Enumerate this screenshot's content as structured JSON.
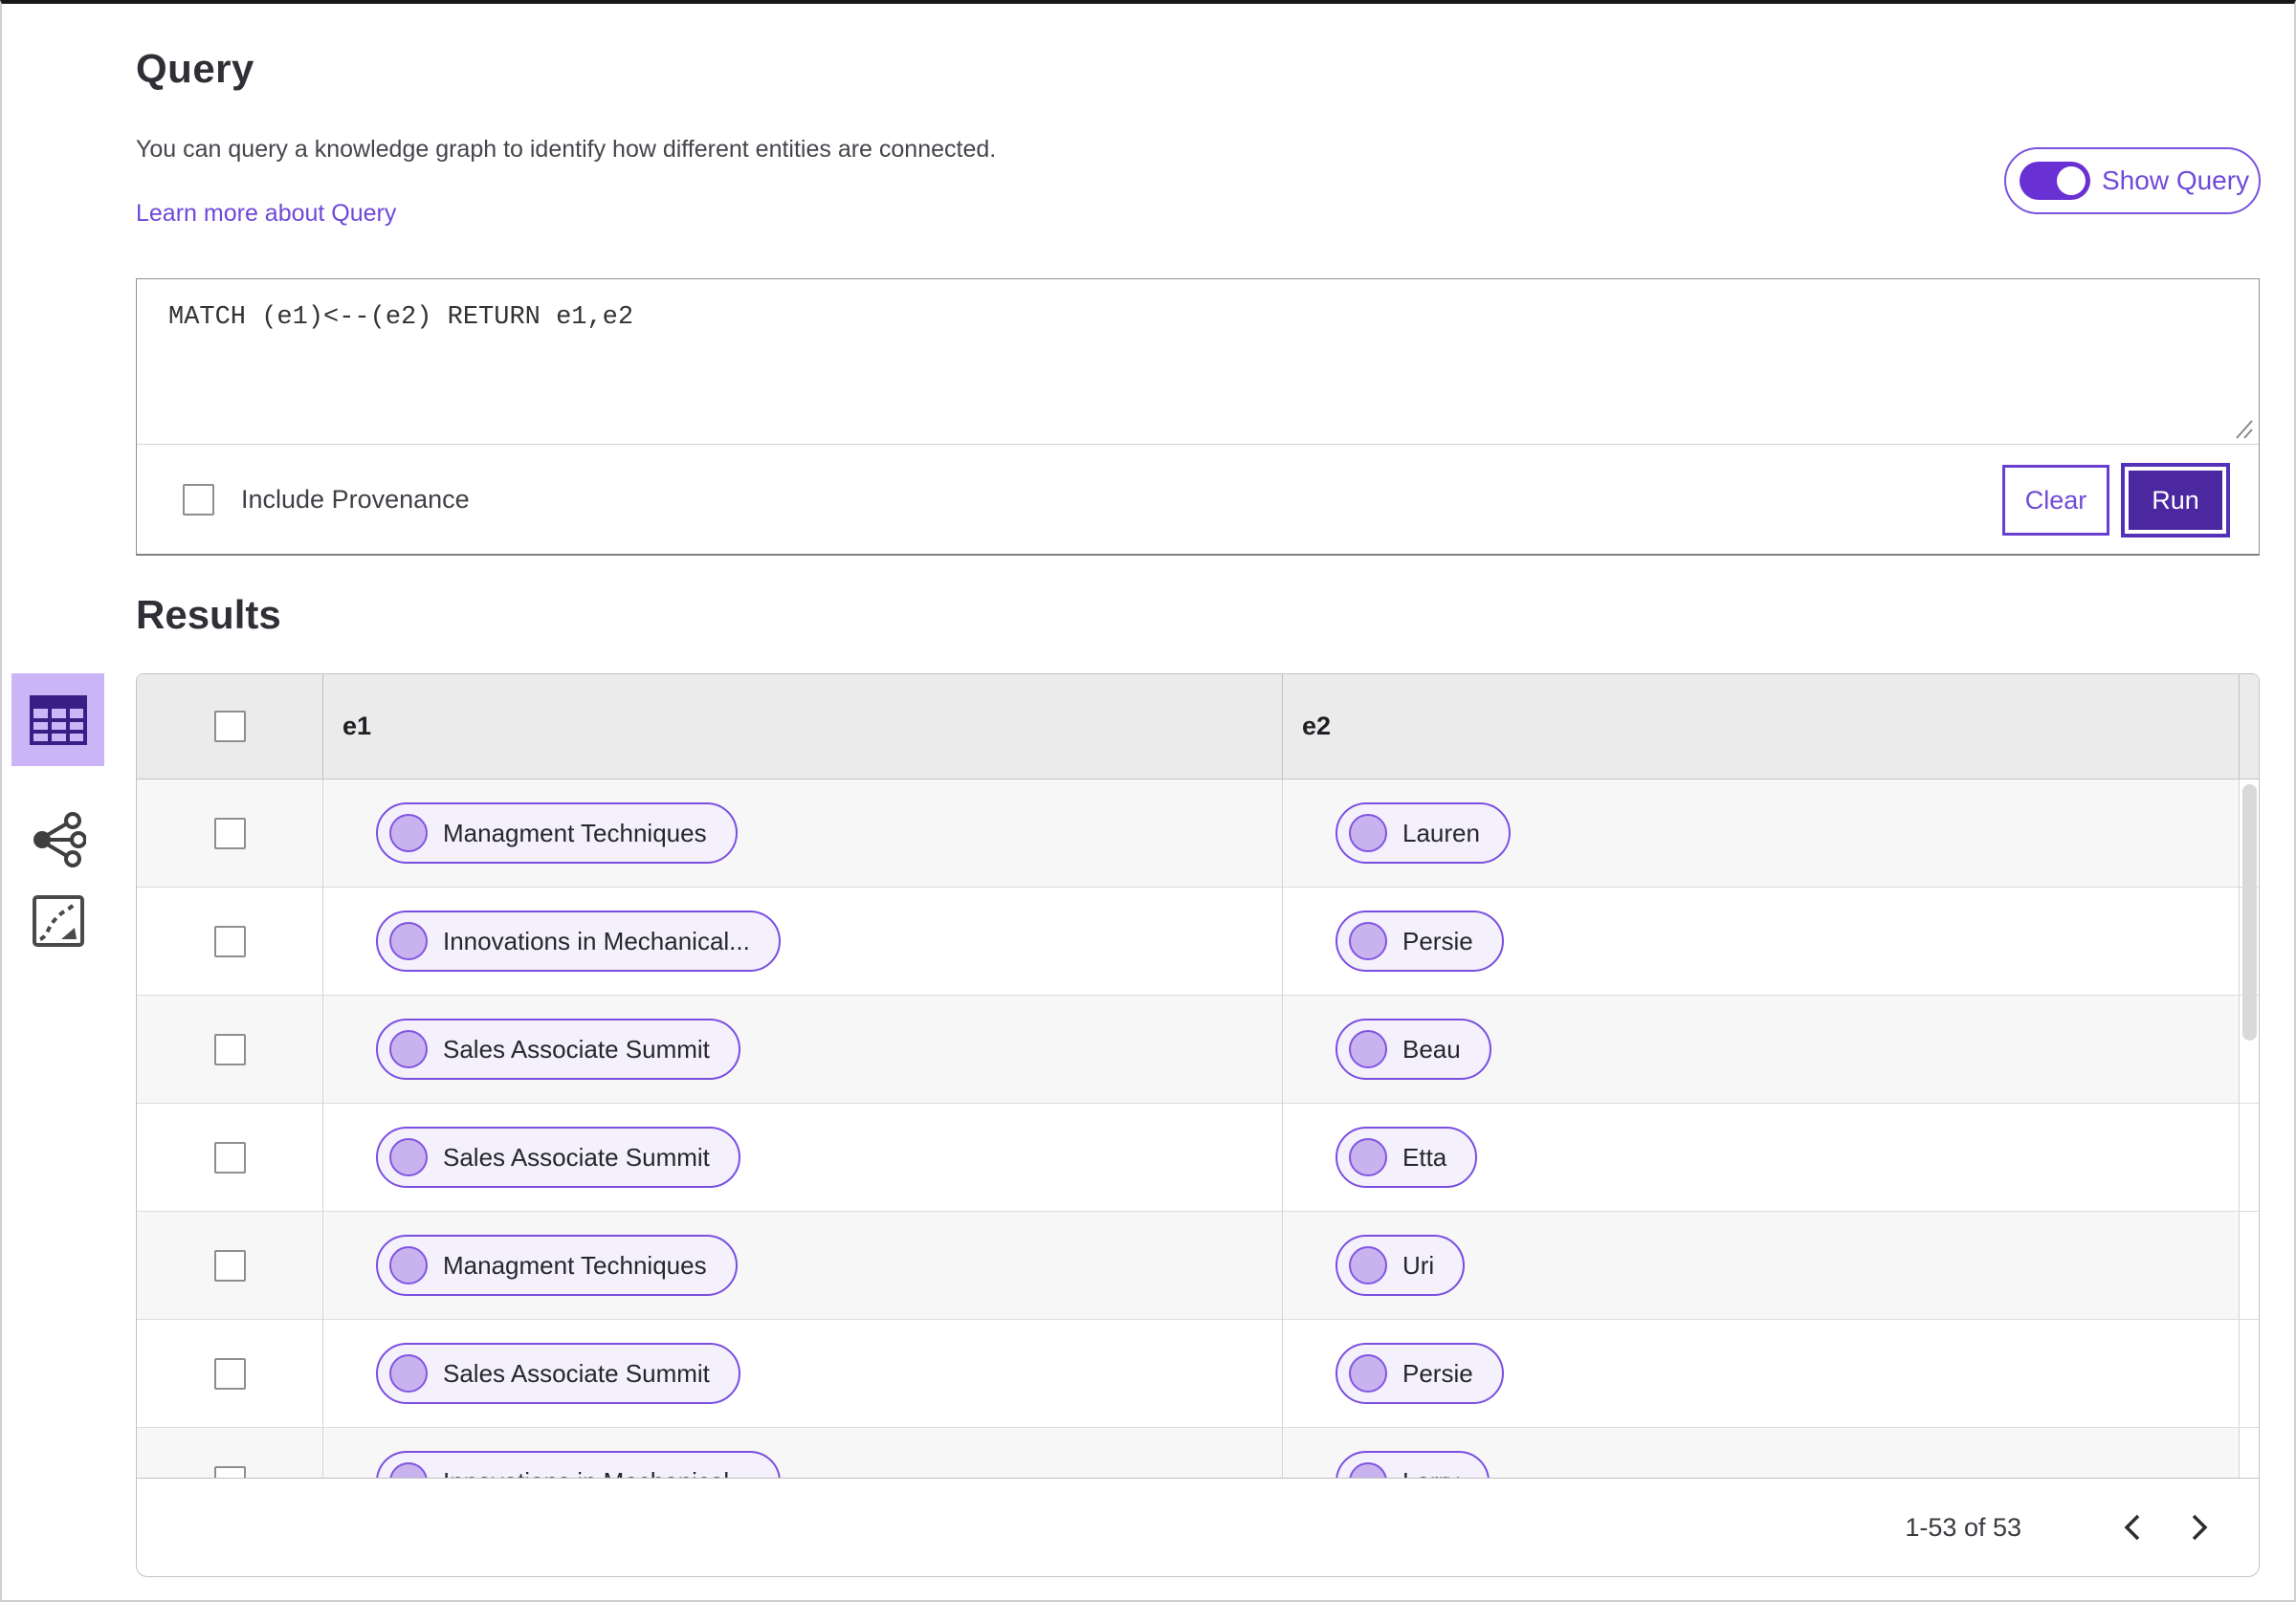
{
  "header": {
    "title": "Query",
    "description": "You can query a knowledge graph to identify how different entities are connected.",
    "learn_more_link": "Learn more about Query",
    "show_query": {
      "label": "Show Query",
      "state": "on"
    }
  },
  "query_panel": {
    "query_text": "MATCH (e1)<--(e2) RETURN e1,e2",
    "include_provenance": {
      "label": "Include Provenance",
      "checked": false
    },
    "clear_label": "Clear",
    "run_label": "Run"
  },
  "results": {
    "title": "Results",
    "view_switcher": {
      "selected": "table-view",
      "icons": [
        "table-view-icon",
        "graph-view-icon",
        "chart-view-icon"
      ]
    },
    "columns": [
      "e1",
      "e2"
    ],
    "rows": [
      {
        "e1": "Managment Techniques",
        "e2": "Lauren"
      },
      {
        "e1": "Innovations in Mechanical...",
        "e2": "Persie"
      },
      {
        "e1": "Sales Associate Summit",
        "e2": "Beau"
      },
      {
        "e1": "Sales Associate Summit",
        "e2": "Etta"
      },
      {
        "e1": "Managment Techniques",
        "e2": "Uri"
      },
      {
        "e1": "Sales Associate Summit",
        "e2": "Persie"
      },
      {
        "e1": "Innovations in Mechanical...",
        "e2": "Larry"
      }
    ],
    "pagination": {
      "range_label": "1-53 of 53",
      "prev_icon": "chevron-left",
      "next_icon": "chevron-right"
    }
  },
  "colors": {
    "accent_purple": "#6e49d8",
    "run_button_bg": "#4b27a0",
    "toggle_on": "#6930d4",
    "pill_border": "#7a4fe0",
    "pill_bg": "#f4f0fc",
    "pill_dot": "#c9b3ef",
    "selected_view_bg": "#cbb5f6",
    "table_header_bg": "#ebebeb",
    "row_alt_bg": "#f7f7f7"
  }
}
